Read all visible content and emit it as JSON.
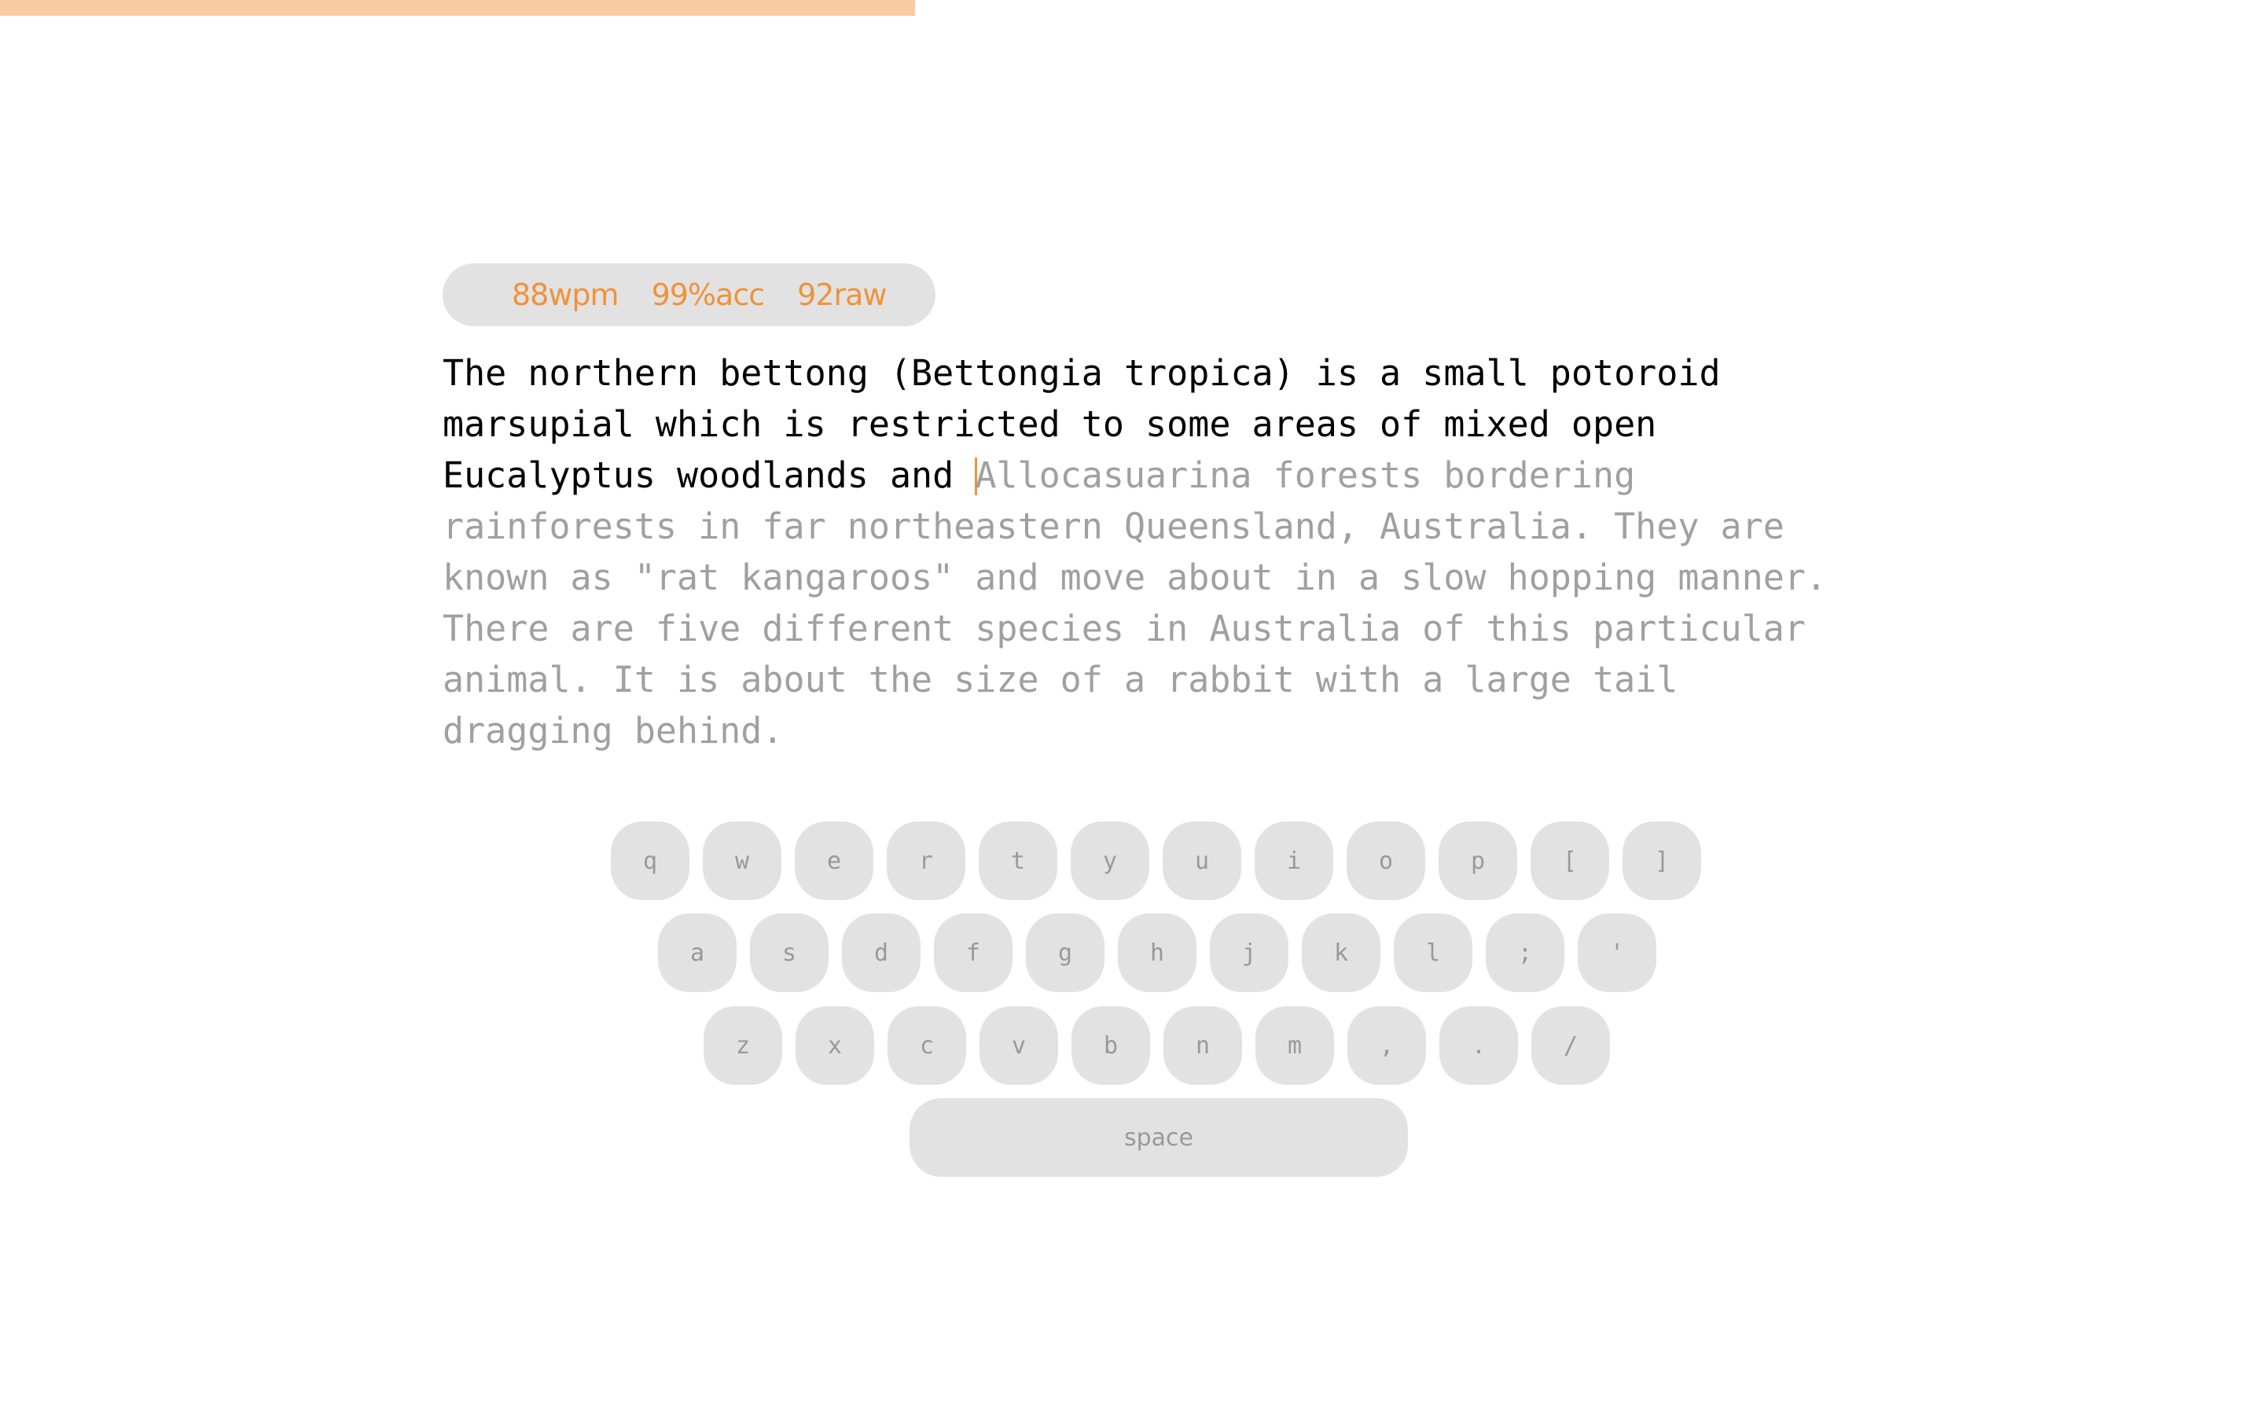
{
  "progress": {
    "fraction": 0.404,
    "color": "#f9cba0"
  },
  "stats": {
    "wpm": "88wpm",
    "acc": "99%acc",
    "raw": "92raw",
    "color": "#f0923a"
  },
  "passage": {
    "typed": "The northern bettong (Bettongia tropica) is a small potoroid marsupial which is restricted to some areas of mixed open Eucalyptus woodlands and ",
    "remaining": "Allocasuarina forests bordering rainforests in far northeastern Queensland, Australia. They are known as \"rat kangaroos\" and move about in a slow hopping manner. There are five different species in Australia of this particular animal. It is about the size of a rabbit with a large tail dragging behind."
  },
  "keyboard": {
    "rows": [
      [
        "q",
        "w",
        "e",
        "r",
        "t",
        "y",
        "u",
        "i",
        "o",
        "p",
        "[",
        "]"
      ],
      [
        "a",
        "s",
        "d",
        "f",
        "g",
        "h",
        "j",
        "k",
        "l",
        ";",
        "'"
      ],
      [
        "z",
        "x",
        "c",
        "v",
        "b",
        "n",
        "m",
        ",",
        ".",
        "/"
      ]
    ],
    "space": "space"
  }
}
